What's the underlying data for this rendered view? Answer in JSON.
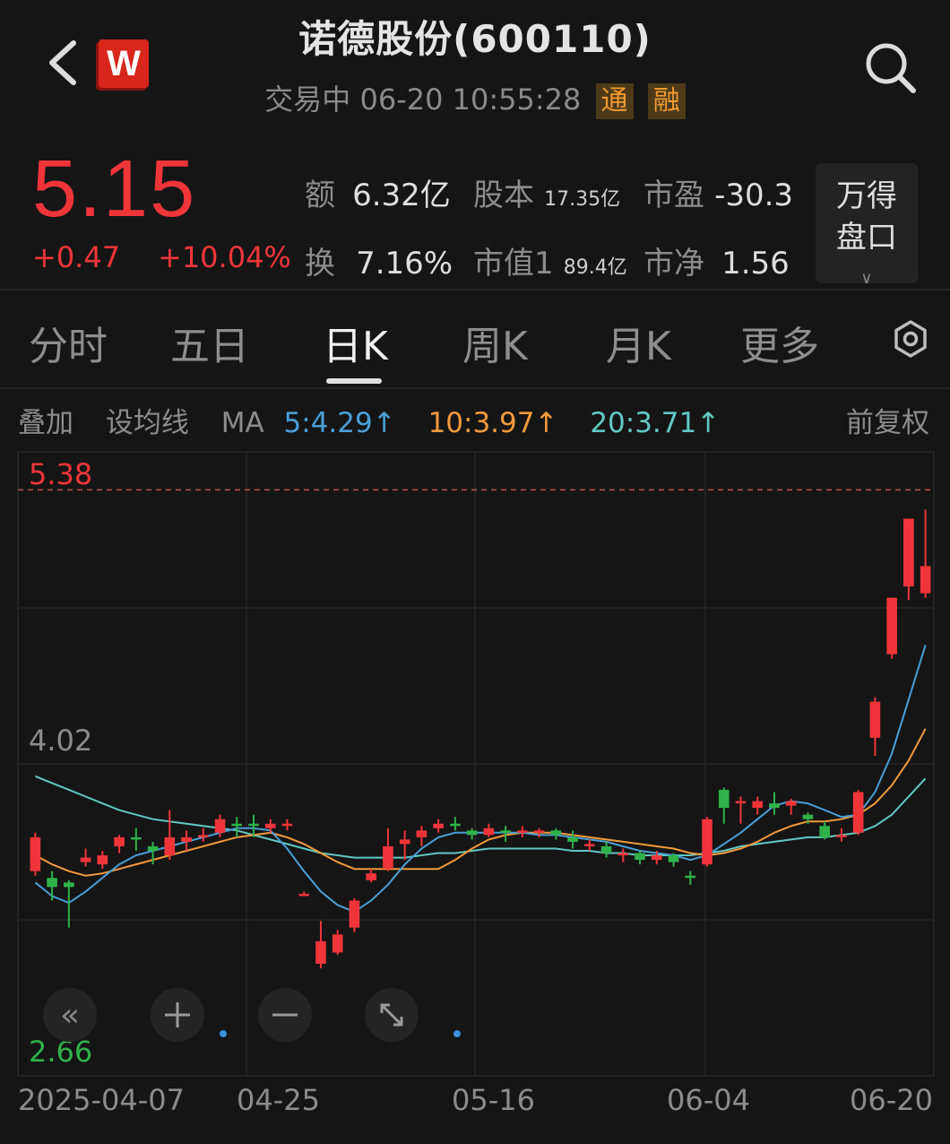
{
  "header": {
    "title": "诺德股份(600110)",
    "status": "交易中 06-20 10:55:28",
    "tag_tong": "通",
    "tag_rong": "融",
    "logo_letter": "W"
  },
  "quote": {
    "price": "5.15",
    "change": "+0.47",
    "change_pct": "+10.04%",
    "stats": {
      "amount_label": "额",
      "amount_value": "6.32亿",
      "equity_label": "股本",
      "equity_value": "17.35亿",
      "pe_label": "市盈",
      "pe_value": "-30.3",
      "turnover_label": "换",
      "turnover_value": "7.16%",
      "mktcap_label": "市值1",
      "mktcap_value": "89.4亿",
      "pb_label": "市净",
      "pb_value": "1.56"
    },
    "pankou_line1": "万得",
    "pankou_line2": "盘口"
  },
  "tabs": [
    "分时",
    "五日",
    "日K",
    "周K",
    "月K",
    "更多"
  ],
  "active_tab": "日K",
  "ma_bar": {
    "overlay": "叠加",
    "set_ma": "设均线",
    "ma": "MA",
    "ma5": "5:4.29↑",
    "ma10": "10:3.97↑",
    "ma20": "20:3.71↑",
    "adjust": "前复权"
  },
  "colors": {
    "up": "#f0353a",
    "down": "#2fb24a",
    "ma5": "#4a9fd8",
    "ma10": "#f39a3c",
    "ma20": "#62c8c2",
    "tag_bg": "#4e3a18",
    "tag_fg": "#f09a32"
  },
  "chart_data": {
    "type": "candlestick",
    "y_high_label": "5.38",
    "y_mid_label": "4.02",
    "y_low_label": "2.66",
    "ylim": [
      2.66,
      5.38
    ],
    "ref_line": 5.15,
    "x_tick_labels": [
      "2025-04-07",
      "04-25",
      "05-16",
      "06-04",
      "06-20"
    ],
    "candles": [
      [
        3.55,
        3.7,
        3.53,
        3.72
      ],
      [
        3.52,
        3.48,
        3.42,
        3.55
      ],
      [
        3.5,
        3.48,
        3.3,
        3.51
      ],
      [
        3.59,
        3.61,
        3.57,
        3.65
      ],
      [
        3.58,
        3.62,
        3.56,
        3.64
      ],
      [
        3.66,
        3.7,
        3.63,
        3.71
      ],
      [
        3.7,
        3.69,
        3.64,
        3.74
      ],
      [
        3.66,
        3.64,
        3.58,
        3.68
      ],
      [
        3.62,
        3.7,
        3.6,
        3.82
      ],
      [
        3.68,
        3.7,
        3.64,
        3.73
      ],
      [
        3.7,
        3.71,
        3.68,
        3.74
      ],
      [
        3.72,
        3.78,
        3.7,
        3.8
      ],
      [
        3.76,
        3.75,
        3.7,
        3.79
      ],
      [
        3.76,
        3.75,
        3.7,
        3.8
      ],
      [
        3.74,
        3.76,
        3.72,
        3.78
      ],
      [
        3.75,
        3.76,
        3.73,
        3.78
      ],
      [
        3.45,
        3.45,
        3.44,
        3.46
      ],
      [
        3.14,
        3.24,
        3.12,
        3.33
      ],
      [
        3.19,
        3.27,
        3.18,
        3.29
      ],
      [
        3.3,
        3.42,
        3.28,
        3.43
      ],
      [
        3.51,
        3.54,
        3.5,
        3.56
      ],
      [
        3.56,
        3.66,
        3.55,
        3.74
      ],
      [
        3.67,
        3.69,
        3.6,
        3.73
      ],
      [
        3.7,
        3.73,
        3.66,
        3.75
      ],
      [
        3.74,
        3.76,
        3.72,
        3.78
      ],
      [
        3.76,
        3.75,
        3.73,
        3.79
      ],
      [
        3.73,
        3.71,
        3.69,
        3.74
      ],
      [
        3.71,
        3.74,
        3.7,
        3.76
      ],
      [
        3.73,
        3.72,
        3.68,
        3.75
      ],
      [
        3.73,
        3.73,
        3.7,
        3.75
      ],
      [
        3.72,
        3.73,
        3.7,
        3.74
      ],
      [
        3.73,
        3.71,
        3.69,
        3.74
      ],
      [
        3.7,
        3.68,
        3.65,
        3.73
      ],
      [
        3.67,
        3.67,
        3.64,
        3.69
      ],
      [
        3.66,
        3.63,
        3.61,
        3.68
      ],
      [
        3.62,
        3.63,
        3.59,
        3.65
      ],
      [
        3.63,
        3.6,
        3.58,
        3.64
      ],
      [
        3.6,
        3.62,
        3.58,
        3.64
      ],
      [
        3.62,
        3.59,
        3.57,
        3.63
      ],
      [
        3.53,
        3.52,
        3.49,
        3.55
      ],
      [
        3.58,
        3.78,
        3.57,
        3.79
      ],
      [
        3.91,
        3.83,
        3.76,
        3.92
      ],
      [
        3.86,
        3.86,
        3.76,
        3.88
      ],
      [
        3.83,
        3.86,
        3.8,
        3.88
      ],
      [
        3.85,
        3.83,
        3.8,
        3.9
      ],
      [
        3.84,
        3.86,
        3.8,
        3.87
      ],
      [
        3.8,
        3.78,
        3.76,
        3.81
      ],
      [
        3.75,
        3.7,
        3.69,
        3.77
      ],
      [
        3.71,
        3.71,
        3.68,
        3.74
      ],
      [
        3.72,
        3.9,
        3.71,
        3.91
      ],
      [
        4.14,
        4.3,
        4.06,
        4.32
      ],
      [
        4.51,
        4.76,
        4.49,
        4.76
      ],
      [
        4.81,
        5.11,
        4.75,
        5.11
      ],
      [
        4.78,
        4.9,
        4.76,
        5.15
      ]
    ],
    "ma5": [
      3.5,
      3.44,
      3.41,
      3.46,
      3.52,
      3.58,
      3.62,
      3.64,
      3.66,
      3.68,
      3.7,
      3.72,
      3.74,
      3.74,
      3.73,
      3.65,
      3.55,
      3.46,
      3.4,
      3.37,
      3.42,
      3.49,
      3.58,
      3.65,
      3.7,
      3.72,
      3.72,
      3.72,
      3.72,
      3.72,
      3.71,
      3.71,
      3.7,
      3.69,
      3.68,
      3.66,
      3.64,
      3.63,
      3.62,
      3.6,
      3.62,
      3.67,
      3.72,
      3.78,
      3.84,
      3.86,
      3.85,
      3.82,
      3.79,
      3.8,
      3.9,
      4.07,
      4.31,
      4.55
    ],
    "ma10": [
      3.62,
      3.58,
      3.55,
      3.53,
      3.54,
      3.56,
      3.58,
      3.6,
      3.62,
      3.64,
      3.66,
      3.68,
      3.7,
      3.71,
      3.72,
      3.7,
      3.67,
      3.63,
      3.59,
      3.56,
      3.56,
      3.56,
      3.56,
      3.56,
      3.56,
      3.6,
      3.65,
      3.69,
      3.71,
      3.72,
      3.72,
      3.72,
      3.71,
      3.7,
      3.69,
      3.68,
      3.67,
      3.66,
      3.65,
      3.63,
      3.62,
      3.63,
      3.65,
      3.68,
      3.72,
      3.75,
      3.77,
      3.77,
      3.78,
      3.8,
      3.85,
      3.93,
      4.04,
      4.18
    ],
    "ma20": [
      3.97,
      3.94,
      3.91,
      3.88,
      3.85,
      3.82,
      3.8,
      3.78,
      3.77,
      3.76,
      3.75,
      3.74,
      3.73,
      3.71,
      3.69,
      3.67,
      3.65,
      3.63,
      3.62,
      3.61,
      3.61,
      3.61,
      3.61,
      3.62,
      3.63,
      3.63,
      3.64,
      3.65,
      3.65,
      3.65,
      3.65,
      3.65,
      3.64,
      3.64,
      3.63,
      3.63,
      3.62,
      3.62,
      3.62,
      3.62,
      3.63,
      3.64,
      3.66,
      3.67,
      3.68,
      3.69,
      3.7,
      3.7,
      3.71,
      3.72,
      3.75,
      3.8,
      3.88,
      3.96
    ]
  }
}
